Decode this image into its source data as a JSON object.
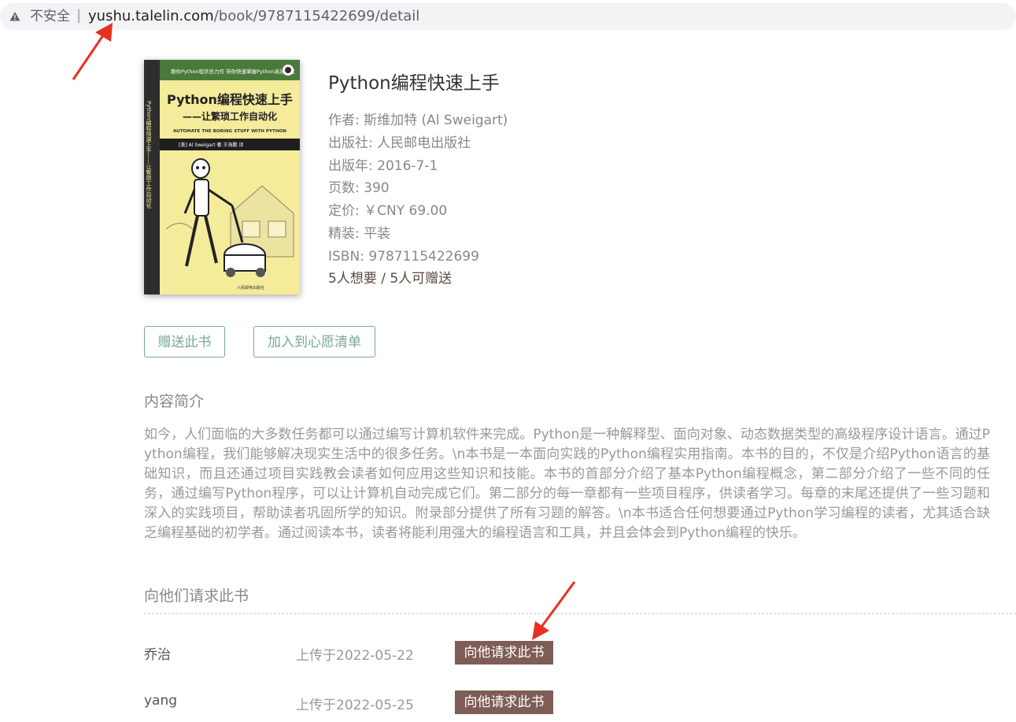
{
  "browser": {
    "security_label": "不安全",
    "separator": "|",
    "url_host": "yushu.talelin.com",
    "url_path": "/book/9787115422699/detail"
  },
  "book": {
    "title": "Python编程快速上手",
    "author": "作者: 斯维加特 (Al Sweigart)",
    "publisher": "出版社: 人民邮电出版社",
    "pubdate": "出版年:   2016-7-1",
    "pages": "页数:   390",
    "price": "定价:   ￥CNY 69.00",
    "binding": "精装:   平装",
    "isbn": "ISBN:   9787115422699",
    "wants": "5人想要 / 5人可赠送",
    "cover": {
      "banner": "教你Python程序员力作  带你快速掌握Python高效编程",
      "title": "Python编程快速上手",
      "subtitle": "——让繁琐工作自动化",
      "english": "AUTOMATE THE BORING STUFF WITH PYTHON",
      "author_line": "[美] Al Sweigart  著      王海鹏  译",
      "spine": "Python编程快速上手——让繁琐工作自动化",
      "publisher_mark": "人民邮电出版社"
    }
  },
  "actions": {
    "gift_label": "赠送此书",
    "wish_label": "加入到心愿清单"
  },
  "summary": {
    "heading": "内容简介",
    "text": "如今，人们面临的大多数任务都可以通过编写计算机软件来完成。Python是一种解释型、面向对象、动态数据类型的高级程序设计语言。通过Python编程，我们能够解决现实生活中的很多任务。\\n本书是一本面向实践的Python编程实用指南。本书的目的，不仅是介绍Python语言的基础知识，而且还通过项目实践教会读者如何应用这些知识和技能。本书的首部分介绍了基本Python编程概念，第二部分介绍了一些不同的任务，通过编写Python程序，可以让计算机自动完成它们。第二部分的每一章都有一些项目程序，供读者学习。每章的末尾还提供了一些习题和深入的实践项目，帮助读者巩固所学的知识。附录部分提供了所有习题的解答。\\n本书适合任何想要通过Python学习编程的读者，尤其适合缺乏编程基础的初学者。通过阅读本书，读者将能利用强大的编程语言和工具，并且会体会到Python编程的快乐。"
  },
  "requests": {
    "heading": "向他们请求此书",
    "items": [
      {
        "name": "乔治",
        "date": "上传于2022-05-22",
        "button": "向他请求此书"
      },
      {
        "name": "yang",
        "date": "上传于2022-05-25",
        "button": "向他请求此书"
      }
    ]
  },
  "colors": {
    "accent_green": "#7aa89a",
    "request_button": "#7d5d55",
    "annotation_arrow": "#e8301f"
  }
}
